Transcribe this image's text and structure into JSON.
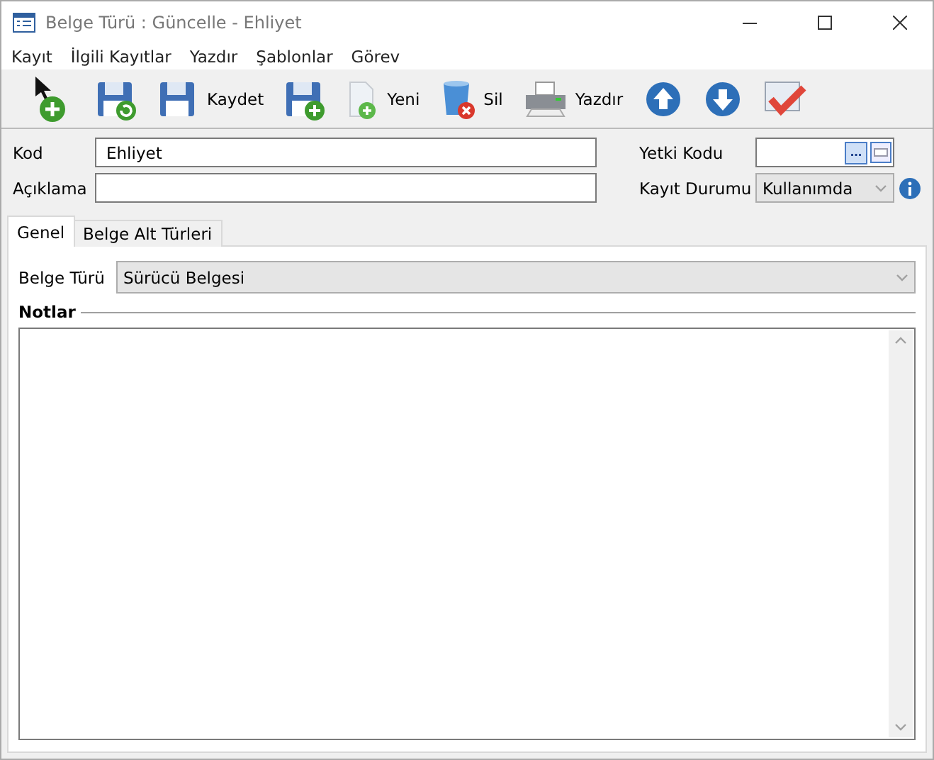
{
  "window": {
    "title": "Belge Türü : Güncelle - Ehliyet"
  },
  "menu": [
    "Kayıt",
    "İlgili Kayıtlar",
    "Yazdır",
    "Şablonlar",
    "Görev"
  ],
  "toolbar": {
    "save": "Kaydet",
    "new": "Yeni",
    "delete": "Sil",
    "print": "Yazdır"
  },
  "form": {
    "kod": {
      "label": "Kod",
      "value": "Ehliyet"
    },
    "aciklama": {
      "label": "Açıklama"
    },
    "yetki_kodu": {
      "label": "Yetki Kodu",
      "button": "..."
    },
    "kayit_durumu": {
      "label": "Kayıt Durumu",
      "value": "Kullanımda"
    }
  },
  "tabs": [
    {
      "label": "Genel",
      "selected": true
    },
    {
      "label": "Belge Alt Türleri",
      "selected": false
    }
  ],
  "genel": {
    "belge_turu": {
      "label": "Belge Türü",
      "value": "Sürücü Belgesi"
    },
    "notlar": {
      "label": "Notlar"
    }
  }
}
